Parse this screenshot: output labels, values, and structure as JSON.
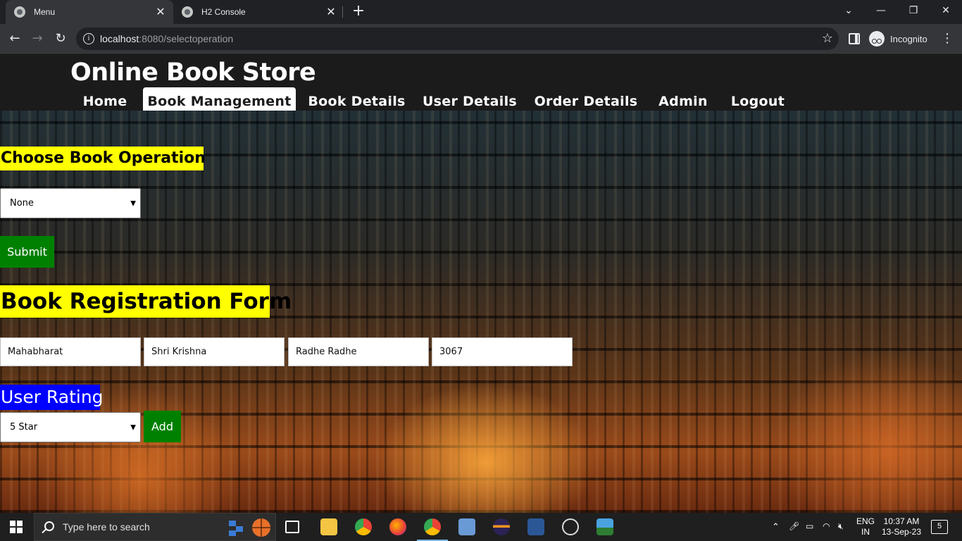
{
  "browser": {
    "tabs": [
      {
        "label": "Menu",
        "active": true
      },
      {
        "label": "H2 Console",
        "active": false
      }
    ],
    "url_host": "localhost",
    "url_rest": ":8080/selectoperation",
    "profile_label": "Incognito"
  },
  "site": {
    "title": "Online Book Store",
    "nav": [
      {
        "label": "Home"
      },
      {
        "label": "Book Management",
        "active": true
      },
      {
        "label": "Book Details"
      },
      {
        "label": "User Details"
      },
      {
        "label": "Order Details"
      },
      {
        "label": "Admin"
      },
      {
        "label": "Logout"
      }
    ]
  },
  "operation": {
    "heading": "Choose Book Operation",
    "selected": "None",
    "submit_label": "Submit"
  },
  "registration": {
    "heading": "Book Registration Form",
    "fields": [
      "Mahabharat",
      "Shri Krishna",
      "Radhe Radhe",
      "3067"
    ]
  },
  "rating": {
    "heading": "User Rating",
    "selected": "5 Star",
    "add_label": "Add"
  },
  "taskbar": {
    "search_placeholder": "Type here to search",
    "lang_top": "ENG",
    "lang_bottom": "IN",
    "time": "10:37 AM",
    "date": "13-Sep-23",
    "notification_count": "5"
  },
  "colors": {
    "heading_yellow": "#ffff00",
    "rating_blue": "#0000ff",
    "button_green": "#008000",
    "header_bg": "#1b1b1b"
  }
}
